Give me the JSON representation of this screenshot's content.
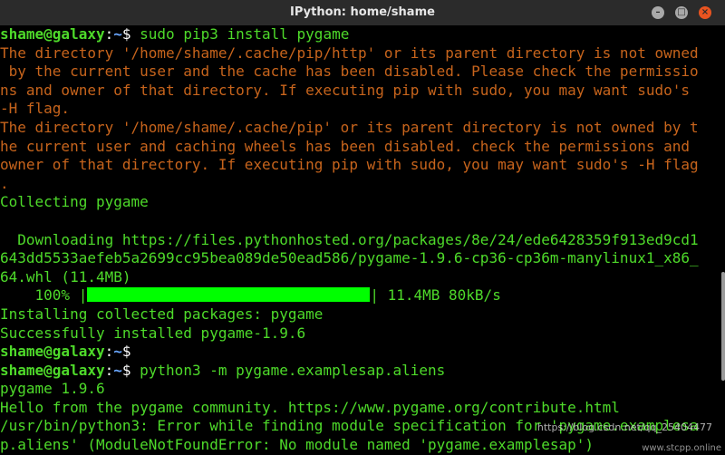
{
  "window": {
    "title": "IPython: home/shame"
  },
  "terminal": {
    "prompt_user": "shame@galaxy",
    "prompt_sep": ":",
    "prompt_path": "~",
    "prompt_sym": "$",
    "cmd1": " sudo pip3 install pygame",
    "warn": [
      "The directory '/home/shame/.cache/pip/http' or its parent directory is not owned",
      " by the current user and the cache has been disabled. Please check the permissio",
      "ns and owner of that directory. If executing pip with sudo, you may want sudo's",
      "-H flag.",
      "The directory '/home/shame/.cache/pip' or its parent directory is not owned by t",
      "he current user and caching wheels has been disabled. check the permissions and",
      "owner of that directory. If executing pip with sudo, you may want sudo's -H flag",
      "."
    ],
    "collecting": "Collecting pygame",
    "downloading": [
      "  Downloading https://files.pythonhosted.org/packages/8e/24/ede6428359f913ed9cd1",
      "643dd5533aefeb5a2699cc95bea089de50ead586/pygame-1.9.6-cp36-cp36m-manylinux1_x86_",
      "64.whl (11.4MB)"
    ],
    "progress_pct": "    100% |",
    "progress_end": "| 11.4MB 80kB/s",
    "progress_fraction": 1.0,
    "installing": "Installing collected packages: pygame",
    "installed": "Successfully installed pygame-1.9.6",
    "cmd3": " python3 -m pygame.examplesap.aliens",
    "out": [
      "pygame 1.9.6",
      "Hello from the pygame community. https://www.pygame.org/contribute.html",
      "/usr/bin/python3: Error while finding module specification for 'pygame.examplesa",
      "p.aliens' (ModuleNotFoundError: No module named 'pygame.examplesap')"
    ]
  },
  "watermarks": {
    "csdn": "https://blog.csdn.net/qq_25404477",
    "site": "www.stcpp.online"
  }
}
